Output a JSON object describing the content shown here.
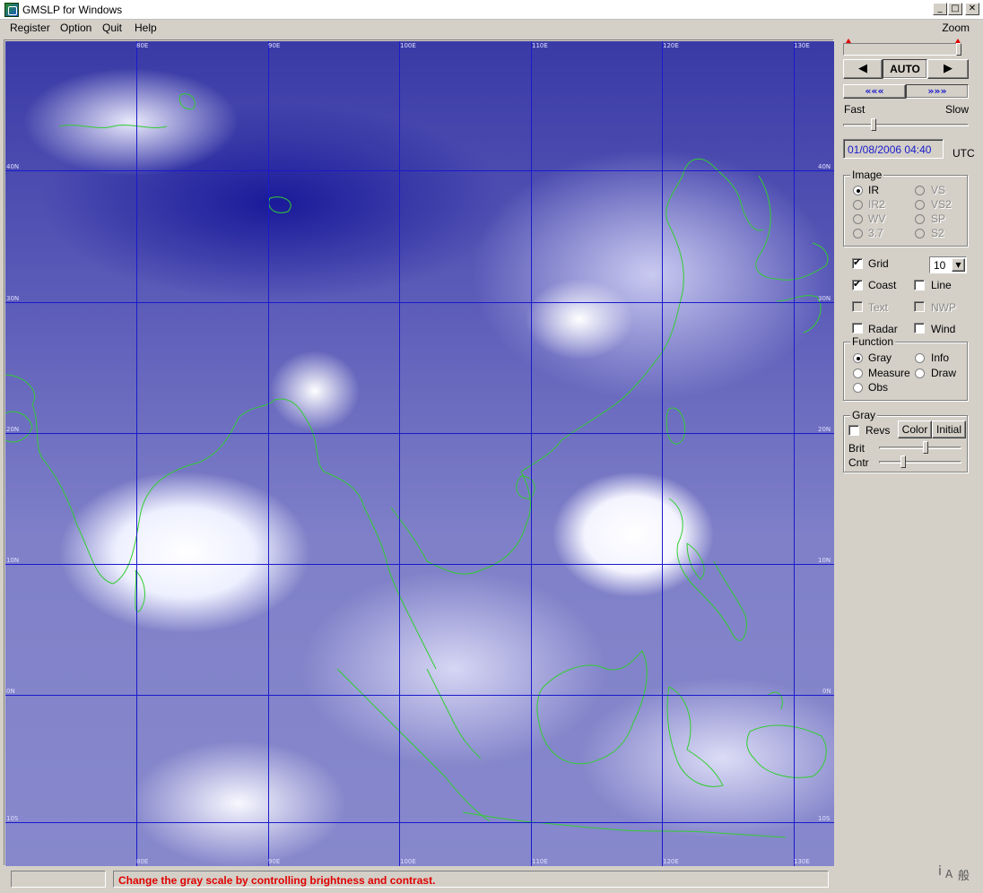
{
  "window": {
    "title": "GMSLP for Windows",
    "minimize_glyph": "_",
    "maximize_glyph": "□",
    "close_glyph": "✕"
  },
  "menu": {
    "items": [
      "Register",
      "Option",
      "Quit",
      "Help"
    ],
    "zoom_label": "Zoom"
  },
  "map": {
    "longitude_labels": [
      "80E",
      "90E",
      "100E",
      "110E",
      "120E",
      "130E"
    ],
    "latitude_labels": [
      "40N",
      "30N",
      "20N",
      "10N",
      "0N",
      "10S"
    ],
    "grid_color": "#1a1acc",
    "coast_color": "#33cc33"
  },
  "animation": {
    "prev_glyph": "◀",
    "auto_label": "AUTO",
    "next_glyph": "▶",
    "rewind_glyph": "«««",
    "forward_glyph": "»»»",
    "fast_label": "Fast",
    "slow_label": "Slow"
  },
  "datetime": {
    "value": "01/08/2006 04:40",
    "timezone": "UTC"
  },
  "image_group": {
    "title": "Image",
    "options": [
      {
        "label": "IR",
        "selected": true,
        "enabled": true
      },
      {
        "label": "VS",
        "selected": false,
        "enabled": false
      },
      {
        "label": "IR2",
        "selected": false,
        "enabled": false
      },
      {
        "label": "VS2",
        "selected": false,
        "enabled": false
      },
      {
        "label": "WV",
        "selected": false,
        "enabled": false
      },
      {
        "label": "SP",
        "selected": false,
        "enabled": false
      },
      {
        "label": "3.7",
        "selected": false,
        "enabled": false
      },
      {
        "label": "S2",
        "selected": false,
        "enabled": false
      }
    ]
  },
  "overlays": {
    "grid_label": "Grid",
    "grid_checked": true,
    "grid_spacing": "10",
    "coast_label": "Coast",
    "coast_checked": true,
    "line_label": "Line",
    "text_label": "Text",
    "nwp_label": "NWP",
    "radar_label": "Radar",
    "wind_label": "Wind"
  },
  "function_group": {
    "title": "Function",
    "options": [
      {
        "label": "Gray",
        "selected": true
      },
      {
        "label": "Info",
        "selected": false
      },
      {
        "label": "Measure",
        "selected": false
      },
      {
        "label": "Draw",
        "selected": false
      },
      {
        "label": "Obs",
        "selected": false
      }
    ]
  },
  "gray_group": {
    "title": "Gray",
    "revs_label": "Revs",
    "color_button": "Color",
    "initial_button": "Initial",
    "brit_label": "Brit",
    "cntr_label": "Cntr"
  },
  "status": {
    "message": "Change the gray scale by controlling brightness and contrast."
  },
  "ime": {
    "indicator": "般"
  }
}
